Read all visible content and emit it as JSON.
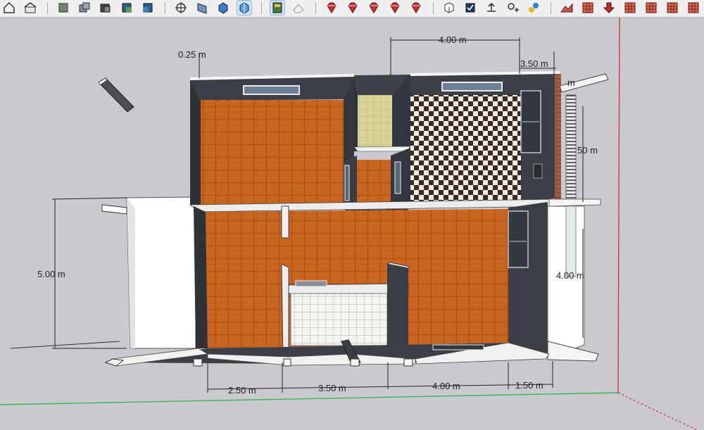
{
  "toolbar": {
    "groups": [
      [
        "home-icon",
        "house-icon"
      ],
      [
        "views-top-icon",
        "views-front-icon",
        "views-right-icon",
        "views-back-icon",
        "views-left-icon"
      ],
      [
        "section-plane-icon",
        "display-section-planes-icon",
        "display-section-cuts-icon",
        "display-section-fill-icon"
      ],
      [
        "book-icon",
        "eraser-icon"
      ],
      [
        "gem-icon",
        "gem-icon",
        "gem-icon",
        "gem-icon",
        "gem-icon"
      ],
      [
        "export-icon",
        "checkbox-icon",
        "upload-icon",
        "add-location-icon",
        "plugin-icon"
      ],
      [
        "terrain-icon",
        "grid-icon",
        "arrow-down-icon",
        "grid-icon",
        "grid-icon",
        "grid-icon",
        "grid-icon"
      ]
    ],
    "active_index": [
      10,
      11
    ]
  },
  "dimensions": {
    "top_width": "4.00 m",
    "top_right": "3.50 m",
    "top_left_thickness": "0.25 m",
    "right_small": "m",
    "right_upper": "50 m",
    "right_lower": "4.00 m",
    "left_height": "5.00 m",
    "bottom_1": "2.50 m",
    "bottom_2": "3.50 m",
    "bottom_3": "4.00 m",
    "bottom_4": "1.50 m"
  },
  "colors": {
    "viewport_bg": "#c9c9cf",
    "floor_orange": "#c8641f",
    "wall_dark": "#3c3f45",
    "wall_top": "#e8e8e8",
    "axis_red": "#d23b3b",
    "axis_green": "#3bb54a"
  }
}
